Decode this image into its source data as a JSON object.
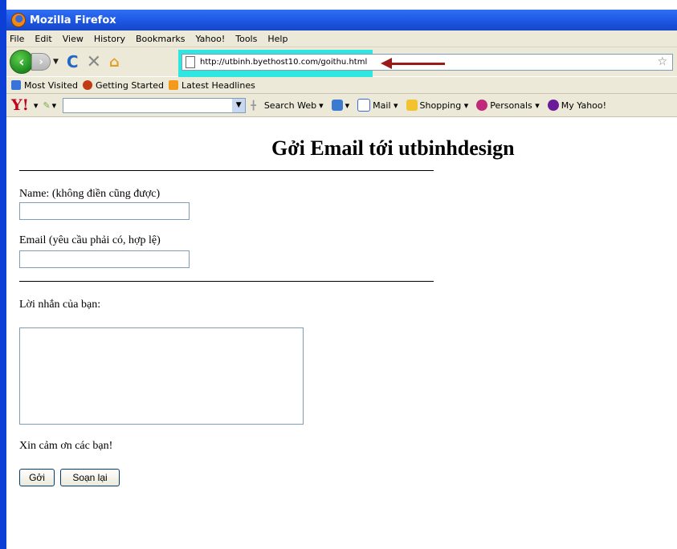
{
  "window": {
    "title": "Mozilla Firefox"
  },
  "menu": [
    "File",
    "Edit",
    "View",
    "History",
    "Bookmarks",
    "Yahoo!",
    "Tools",
    "Help"
  ],
  "nav": {
    "url": "http://utbinh.byethost10.com/goithu.html"
  },
  "bookmarks": [
    "Most Visited",
    "Getting Started",
    "Latest Headlines"
  ],
  "yahoo_toolbar": {
    "logo": "Y!",
    "search_label": "Search Web",
    "items": [
      "Mail",
      "Shopping",
      "Personals",
      "My Yahoo!"
    ]
  },
  "page": {
    "heading": "Gởi Email tới utbinhdesign",
    "name_label": "Name: (không điền cũng được)",
    "email_label": "Email (yêu cầu phải có, hợp lệ)",
    "message_label": "Lời nhắn của bạn:",
    "thanks": "Xin cảm ơn các bạn!",
    "send_button": "Gởi",
    "reset_button": "Soạn lại"
  },
  "colors": {
    "highlight": "#2fe7e0",
    "arrow": "#9b1b1b",
    "titlebar": "#1b55e0"
  }
}
